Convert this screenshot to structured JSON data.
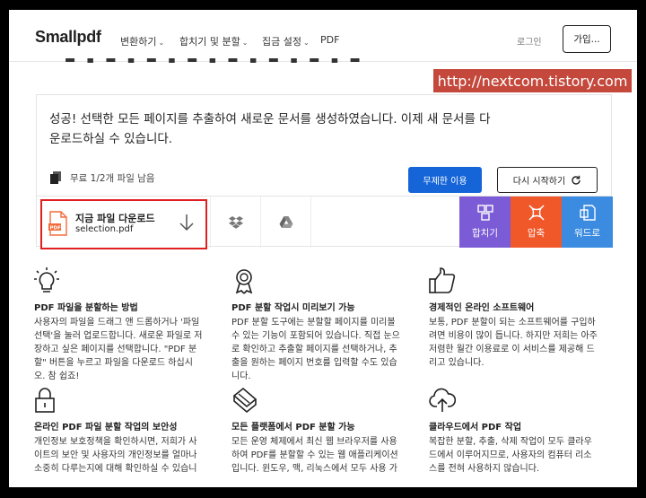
{
  "header": {
    "logo": "Smallpdf",
    "nav": [
      {
        "label": "변환하기",
        "has_menu": true
      },
      {
        "label": "합치기 및 분할",
        "has_menu": true
      },
      {
        "label": "집금 설정",
        "has_menu": true
      },
      {
        "label": "PDF",
        "has_menu": false
      }
    ],
    "login": "로그인",
    "signup": "가입..."
  },
  "watermark": "http://nextcom.tistory.com",
  "success": {
    "message": "성공! 선택한 모든 페이지를 추출하여 새로운 문서를 생성하였습니다. 이제 새 문서를 다운로드하실 수 있습니다.",
    "remaining": "무료 1/2개 파일 남음",
    "unlimited_button": "무제한 이용",
    "restart_button": "다시 시작하기"
  },
  "download": {
    "title": "지금 파일 다운로드",
    "filename": "selection.pdf",
    "pdf_badge": "PDF"
  },
  "actions": [
    {
      "label": "합치기",
      "color": "#7b5cd6",
      "icon": "merge-icon"
    },
    {
      "label": "압축",
      "color": "#f0582a",
      "icon": "compress-icon"
    },
    {
      "label": "워드로",
      "color": "#3b8be0",
      "icon": "word-icon"
    }
  ],
  "features": [
    {
      "icon": "lightbulb-icon",
      "title": "PDF 파일을 분할하는 방법",
      "body": [
        "사용자의 파일을 드래그 앤 드롭하거나 '파일",
        "선택'을 눌러 업로드합니다. 새로운 파일로 저",
        "장하고 싶은 페이지를 선택합니다. \"PDF 분",
        "할\" 버튼을 누르고 파일을 다운로드 하십시",
        "오. 참 쉽죠!"
      ]
    },
    {
      "icon": "award-icon",
      "title": "PDF 분할 작업시 미리보기 가능",
      "body": [
        "PDF 분할 도구에는 분할할 페이지를 미리볼",
        "수 있는 기능이 포함되어 있습니다. 직접 눈으",
        "로 확인하고 추출할 페이지를 선택하거나, 추",
        "출을 원하는 페이지 번호를 입력할 수도 있습",
        "니다."
      ]
    },
    {
      "icon": "thumbs-up-icon",
      "title": "경제적인 온라인 소프트웨어",
      "body": [
        "보통, PDF 분할이 되는 소프트웨어를 구입하",
        "려면 비용이 많이 듭니다. 하지만 저희는 아주",
        "저렴한 월간 이용료로 이 서비스를 제공해 드",
        "리고 있습니다."
      ]
    },
    {
      "icon": "lock-icon",
      "title": "온라인 PDF 파일 분할 작업의 보안성",
      "body": [
        "개인정보 보호정책을 확인하시면, 저희가 사",
        "이트의 보안 및 사용자의 개인정보를 얼마나",
        "소중히 다루는지에 대해 확인하실 수 있습니"
      ]
    },
    {
      "icon": "platforms-icon",
      "title": "모든 플랫폼에서 PDF 분할 가능",
      "body": [
        "모든 운영 체제에서 최신 웹 브라우저를 사용",
        "하여 PDF를 분할할 수 있는 웹 애플리케이션",
        "입니다. 윈도우, 맥, 리눅스에서 모두 사용 가"
      ]
    },
    {
      "icon": "cloud-upload-icon",
      "title": "클라우드에서 PDF 작업",
      "body": [
        "복잡한 분할, 추출, 삭제 작업이 모두 클라우",
        "드에서 이루어지므로, 사용자의 컴퓨터 리소",
        "스를 전혀 사용하지 않습니다."
      ]
    }
  ]
}
